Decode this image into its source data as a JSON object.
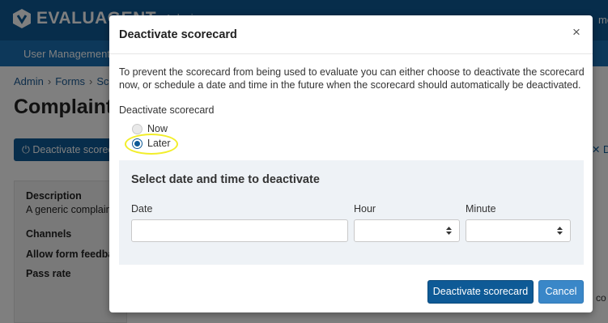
{
  "background": {
    "brand": "EVALUAGENT",
    "brand_suffix": "Admin",
    "topbar_right": "me",
    "subnav_item": "User Management",
    "breadcrumbs": [
      "Admin",
      "Forms",
      "Sco"
    ],
    "page_title": "Complaint",
    "deactivate_button": "Deactivate scorecard",
    "right_link": "D",
    "right_link2": "co",
    "details": {
      "description_label": "Description",
      "description_value": "A generic complaint",
      "channels_label": "Channels",
      "allow_feedback_label": "Allow form feedback",
      "pass_rate_label": "Pass rate"
    }
  },
  "modal": {
    "title": "Deactivate scorecard",
    "close_symbol": "×",
    "description": "To prevent the scorecard from being used to evaluate you can either choose to deactivate the scorecard now, or schedule a date and time in the future when the scorecard should automatically be deactivated.",
    "option_label": "Deactivate scorecard",
    "options": [
      {
        "label": "Now",
        "selected": false
      },
      {
        "label": "Later",
        "selected": true
      }
    ],
    "schedule": {
      "title": "Select date and time to deactivate",
      "date_label": "Date",
      "date_value": "",
      "hour_label": "Hour",
      "hour_value": "",
      "minute_label": "Minute",
      "minute_value": ""
    },
    "buttons": {
      "confirm": "Deactivate scorecard",
      "cancel": "Cancel"
    }
  },
  "colors": {
    "brand_dark": "#0e5a96",
    "brand_light": "#1a70b5",
    "cancel": "#3a87c8",
    "highlight": "#f2ee2a",
    "panel": "#eef2f6"
  }
}
